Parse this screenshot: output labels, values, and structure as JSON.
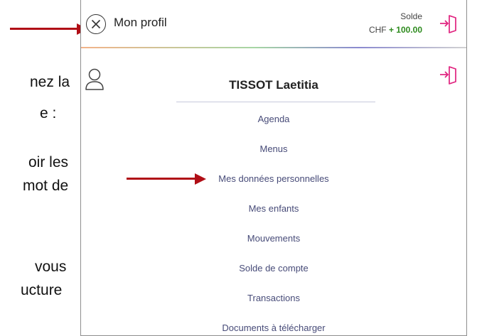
{
  "left_doc": {
    "line1": "nez la",
    "line2": "e :",
    "line3": "oir les",
    "line4": "mot de",
    "line5": "vous",
    "line6": "ucture"
  },
  "header": {
    "title": "Mon profil",
    "solde_label": "Solde",
    "solde_currency": "CHF",
    "solde_value": "+ 100.00"
  },
  "profile": {
    "name": "TISSOT Laetitia"
  },
  "menu": [
    {
      "label": "Agenda"
    },
    {
      "label": "Menus"
    },
    {
      "label": "Mes données personnelles"
    },
    {
      "label": "Mes enfants"
    },
    {
      "label": "Mouvements"
    },
    {
      "label": "Solde de compte"
    },
    {
      "label": "Transactions"
    },
    {
      "label": "Documents à télécharger"
    }
  ],
  "colors": {
    "arrow": "#b00e16",
    "accent_pink": "#e0217e",
    "positive": "#2e8b1e",
    "menu_text": "#474b78"
  },
  "icons": [
    "close-icon",
    "logout-icon",
    "user-icon",
    "arrow-icon"
  ]
}
